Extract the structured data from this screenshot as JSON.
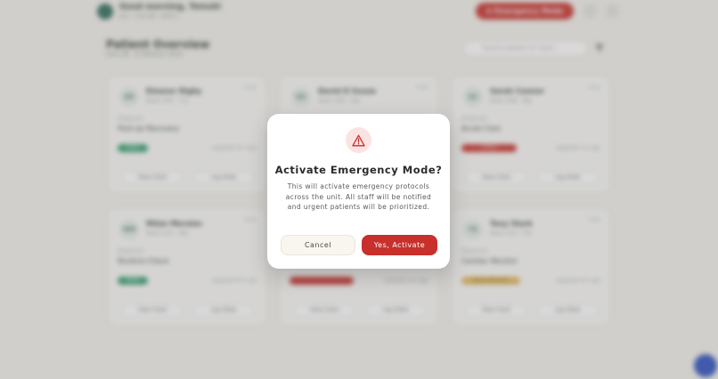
{
  "header": {
    "greeting": "Good morning, Tomuki",
    "subtitle": "ICU · 7:42 AM · Shift 2",
    "emergency_label": "⊕ Emergency Mode"
  },
  "overview": {
    "title": "Patient Overview",
    "subtitle": "Unit 2B · 6 Patients Total",
    "search_placeholder": "Search patient or room..."
  },
  "cards": [
    {
      "initials": "ER",
      "name": "Eleanor Rigby",
      "room": "Room 204 · 71y",
      "diag_label": "Diagnosis",
      "diagnosis": "Post-op Recovery",
      "status": "Stable",
      "status_color": "#2e9a6a",
      "updated": "Updated 2m ago",
      "view": "View Chart",
      "log": "Log Vitals"
    },
    {
      "initials": "DS",
      "name": "David D Souza",
      "room": "Room 206 · 63y",
      "diag_label": "",
      "diagnosis": "",
      "status": "",
      "status_color": "#2e9a6a",
      "updated": "",
      "view": "",
      "log": ""
    },
    {
      "initials": "SC",
      "name": "Sarah Connor",
      "room": "Room 208 · 58y",
      "diag_label": "Diagnosis",
      "diagnosis": "Acute Care",
      "status": "Critical",
      "status_color": "#c8302b",
      "updated": "Updated 1m ago",
      "view": "View Chart",
      "log": "Log Vitals"
    },
    {
      "initials": "MM",
      "name": "Milan Morales",
      "room": "Room 210 · 49y",
      "diag_label": "Diagnosis",
      "diagnosis": "Routine Check",
      "status": "Stable",
      "status_color": "#2e9a6a",
      "updated": "Updated 5m ago",
      "view": "View Chart",
      "log": "Log Vitals"
    },
    {
      "initials": "",
      "name": "",
      "room": "",
      "diag_label": "",
      "diagnosis": "",
      "status": "",
      "status_color": "#c8302b",
      "updated": "Updated 3m ago",
      "view": "View Chart",
      "log": "Log Vitals"
    },
    {
      "initials": "TS",
      "name": "Tony Stark",
      "room": "Room 214 · 53y",
      "diag_label": "Diagnosis",
      "diagnosis": "Cardiac Monitor",
      "status": "Needs Attention",
      "status_color": "#e0b458",
      "updated": "Updated 4m ago",
      "view": "View Chart",
      "log": "Log Vitals"
    }
  ],
  "modal": {
    "title": "Activate Emergency Mode?",
    "body": "This will activate emergency protocols across the unit. All staff will be notified and urgent patients will be prioritized.",
    "cancel_label": "Cancel",
    "confirm_label": "Yes, Activate",
    "icon": "warning-triangle-icon",
    "accent": "#c8302b"
  }
}
